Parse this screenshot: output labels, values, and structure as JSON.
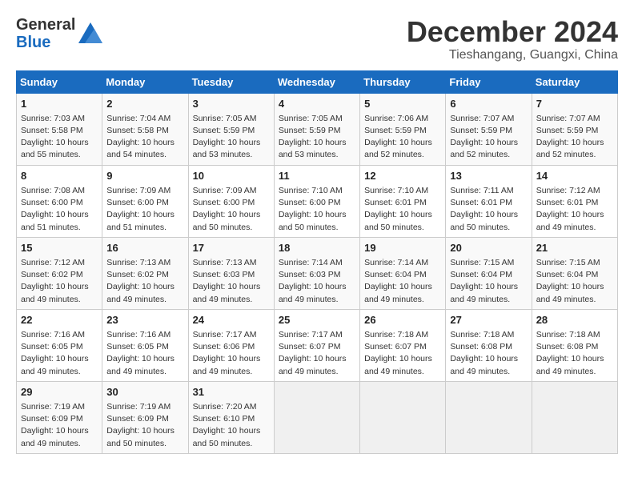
{
  "logo": {
    "general": "General",
    "blue": "Blue"
  },
  "header": {
    "month": "December 2024",
    "location": "Tieshangang, Guangxi, China"
  },
  "weekdays": [
    "Sunday",
    "Monday",
    "Tuesday",
    "Wednesday",
    "Thursday",
    "Friday",
    "Saturday"
  ],
  "weeks": [
    [
      {
        "day": "1",
        "info": "Sunrise: 7:03 AM\nSunset: 5:58 PM\nDaylight: 10 hours\nand 55 minutes."
      },
      {
        "day": "2",
        "info": "Sunrise: 7:04 AM\nSunset: 5:58 PM\nDaylight: 10 hours\nand 54 minutes."
      },
      {
        "day": "3",
        "info": "Sunrise: 7:05 AM\nSunset: 5:59 PM\nDaylight: 10 hours\nand 53 minutes."
      },
      {
        "day": "4",
        "info": "Sunrise: 7:05 AM\nSunset: 5:59 PM\nDaylight: 10 hours\nand 53 minutes."
      },
      {
        "day": "5",
        "info": "Sunrise: 7:06 AM\nSunset: 5:59 PM\nDaylight: 10 hours\nand 52 minutes."
      },
      {
        "day": "6",
        "info": "Sunrise: 7:07 AM\nSunset: 5:59 PM\nDaylight: 10 hours\nand 52 minutes."
      },
      {
        "day": "7",
        "info": "Sunrise: 7:07 AM\nSunset: 5:59 PM\nDaylight: 10 hours\nand 52 minutes."
      }
    ],
    [
      {
        "day": "8",
        "info": "Sunrise: 7:08 AM\nSunset: 6:00 PM\nDaylight: 10 hours\nand 51 minutes."
      },
      {
        "day": "9",
        "info": "Sunrise: 7:09 AM\nSunset: 6:00 PM\nDaylight: 10 hours\nand 51 minutes."
      },
      {
        "day": "10",
        "info": "Sunrise: 7:09 AM\nSunset: 6:00 PM\nDaylight: 10 hours\nand 50 minutes."
      },
      {
        "day": "11",
        "info": "Sunrise: 7:10 AM\nSunset: 6:00 PM\nDaylight: 10 hours\nand 50 minutes."
      },
      {
        "day": "12",
        "info": "Sunrise: 7:10 AM\nSunset: 6:01 PM\nDaylight: 10 hours\nand 50 minutes."
      },
      {
        "day": "13",
        "info": "Sunrise: 7:11 AM\nSunset: 6:01 PM\nDaylight: 10 hours\nand 50 minutes."
      },
      {
        "day": "14",
        "info": "Sunrise: 7:12 AM\nSunset: 6:01 PM\nDaylight: 10 hours\nand 49 minutes."
      }
    ],
    [
      {
        "day": "15",
        "info": "Sunrise: 7:12 AM\nSunset: 6:02 PM\nDaylight: 10 hours\nand 49 minutes."
      },
      {
        "day": "16",
        "info": "Sunrise: 7:13 AM\nSunset: 6:02 PM\nDaylight: 10 hours\nand 49 minutes."
      },
      {
        "day": "17",
        "info": "Sunrise: 7:13 AM\nSunset: 6:03 PM\nDaylight: 10 hours\nand 49 minutes."
      },
      {
        "day": "18",
        "info": "Sunrise: 7:14 AM\nSunset: 6:03 PM\nDaylight: 10 hours\nand 49 minutes."
      },
      {
        "day": "19",
        "info": "Sunrise: 7:14 AM\nSunset: 6:04 PM\nDaylight: 10 hours\nand 49 minutes."
      },
      {
        "day": "20",
        "info": "Sunrise: 7:15 AM\nSunset: 6:04 PM\nDaylight: 10 hours\nand 49 minutes."
      },
      {
        "day": "21",
        "info": "Sunrise: 7:15 AM\nSunset: 6:04 PM\nDaylight: 10 hours\nand 49 minutes."
      }
    ],
    [
      {
        "day": "22",
        "info": "Sunrise: 7:16 AM\nSunset: 6:05 PM\nDaylight: 10 hours\nand 49 minutes."
      },
      {
        "day": "23",
        "info": "Sunrise: 7:16 AM\nSunset: 6:05 PM\nDaylight: 10 hours\nand 49 minutes."
      },
      {
        "day": "24",
        "info": "Sunrise: 7:17 AM\nSunset: 6:06 PM\nDaylight: 10 hours\nand 49 minutes."
      },
      {
        "day": "25",
        "info": "Sunrise: 7:17 AM\nSunset: 6:07 PM\nDaylight: 10 hours\nand 49 minutes."
      },
      {
        "day": "26",
        "info": "Sunrise: 7:18 AM\nSunset: 6:07 PM\nDaylight: 10 hours\nand 49 minutes."
      },
      {
        "day": "27",
        "info": "Sunrise: 7:18 AM\nSunset: 6:08 PM\nDaylight: 10 hours\nand 49 minutes."
      },
      {
        "day": "28",
        "info": "Sunrise: 7:18 AM\nSunset: 6:08 PM\nDaylight: 10 hours\nand 49 minutes."
      }
    ],
    [
      {
        "day": "29",
        "info": "Sunrise: 7:19 AM\nSunset: 6:09 PM\nDaylight: 10 hours\nand 49 minutes."
      },
      {
        "day": "30",
        "info": "Sunrise: 7:19 AM\nSunset: 6:09 PM\nDaylight: 10 hours\nand 50 minutes."
      },
      {
        "day": "31",
        "info": "Sunrise: 7:20 AM\nSunset: 6:10 PM\nDaylight: 10 hours\nand 50 minutes."
      },
      {
        "day": "",
        "info": ""
      },
      {
        "day": "",
        "info": ""
      },
      {
        "day": "",
        "info": ""
      },
      {
        "day": "",
        "info": ""
      }
    ]
  ]
}
